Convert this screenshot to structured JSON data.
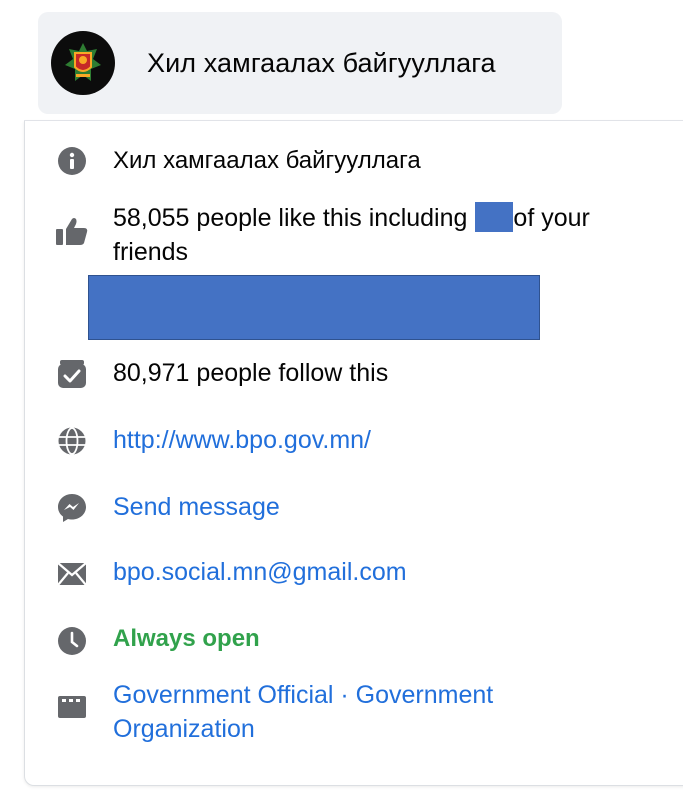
{
  "header": {
    "page_name": "Хил хамгаалах байгууллага"
  },
  "about": {
    "name_row": "Хил хамгаалах байгууллага",
    "likes_text": "58,055 people like this including",
    "likes_suffix": "of your",
    "likes_line2": "friends",
    "follow_text": "80,971 people follow this",
    "website": "http://www.bpo.gov.mn/",
    "send_message": "Send message",
    "email": "bpo.social.mn@gmail.com",
    "hours": "Always open",
    "category_line1": "Government Official · Government",
    "category_line2": "Organization"
  },
  "icons": {
    "info": "info-icon",
    "like": "thumbs-up-icon",
    "follow": "follow-check-icon",
    "website": "globe-icon",
    "messenger": "messenger-icon",
    "email": "envelope-icon",
    "hours": "clock-icon",
    "category": "folder-icon"
  },
  "colors": {
    "link": "#216fdb",
    "open": "#31a24c",
    "icon_gray": "#65676b",
    "redaction": "#4472c4"
  }
}
